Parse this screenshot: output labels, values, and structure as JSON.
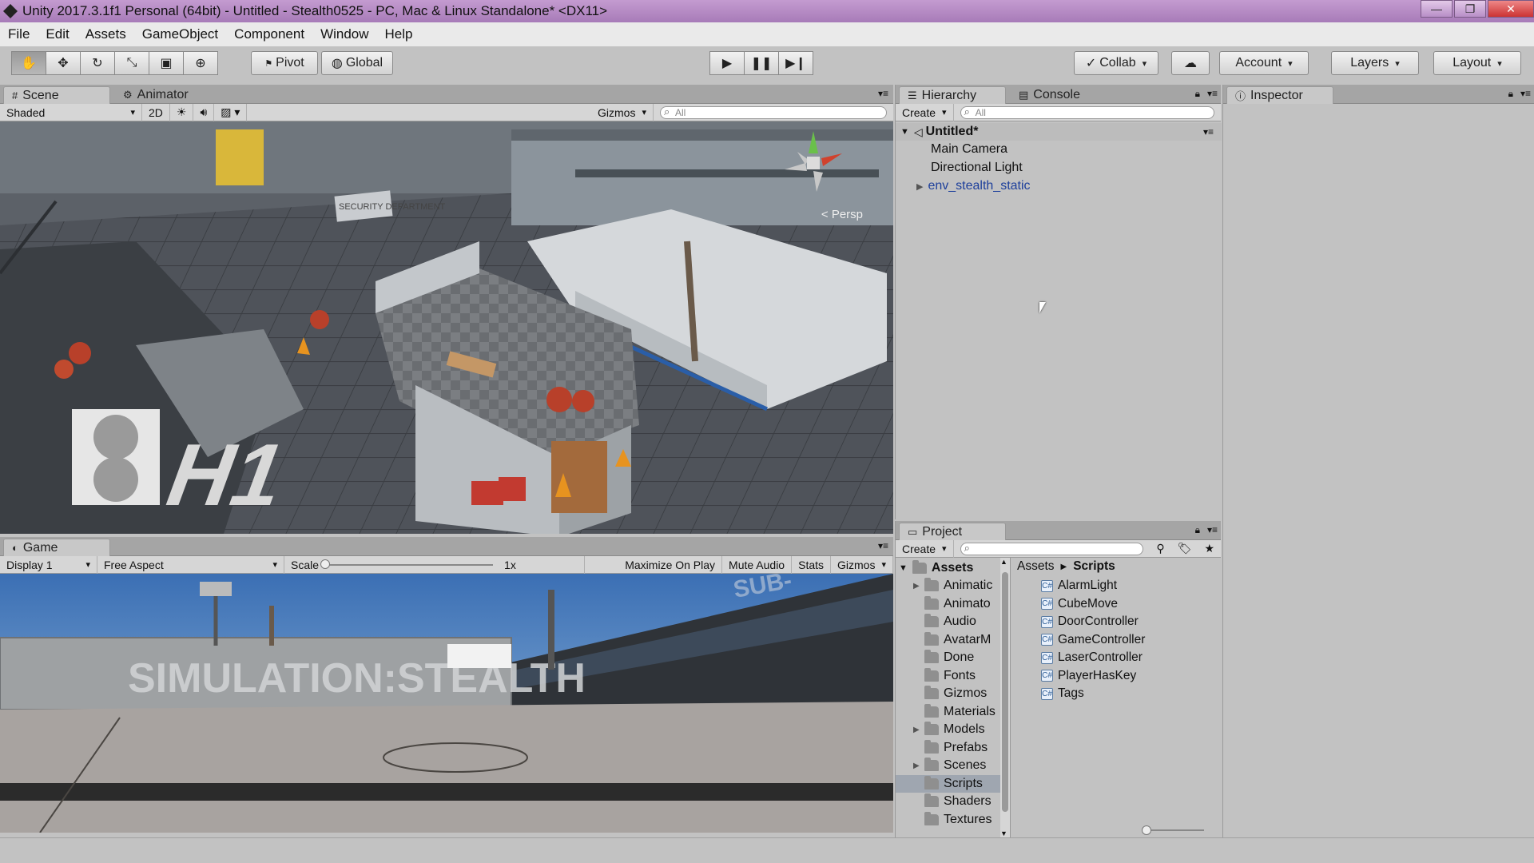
{
  "window": {
    "title": "Unity 2017.3.1f1 Personal (64bit) - Untitled - Stealth0525 - PC, Mac & Linux Standalone* <DX11>",
    "minimize": "—",
    "restore": "❐",
    "close": "✕"
  },
  "menu": [
    "File",
    "Edit",
    "Assets",
    "GameObject",
    "Component",
    "Window",
    "Help"
  ],
  "toolbar": {
    "pivot": "Pivot",
    "global": "Global",
    "collab": "Collab",
    "account": "Account",
    "layers": "Layers",
    "layout": "Layout"
  },
  "scene": {
    "tab_scene": "Scene",
    "tab_animator": "Animator",
    "shading": "Shaded",
    "mode2d": "2D",
    "gizmos": "Gizmos",
    "search_placeholder": "All",
    "persp_label": "Persp",
    "signs": {
      "security": "SECURITY DEPARTMENT",
      "pad": "H1"
    }
  },
  "hierarchy": {
    "tab_hierarchy": "Hierarchy",
    "tab_console": "Console",
    "create": "Create",
    "search_placeholder": "All",
    "scene_name": "Untitled*",
    "items": [
      "Main Camera",
      "Directional Light",
      "env_stealth_static"
    ]
  },
  "inspector": {
    "tab": "Inspector"
  },
  "game": {
    "tab": "Game",
    "display": "Display 1",
    "aspect": "Free Aspect",
    "scale_label": "Scale",
    "scale_value": "1x",
    "maximize": "Maximize On Play",
    "mute": "Mute Audio",
    "stats": "Stats",
    "gizmos": "Gizmos",
    "wall_text": "SIMULATION:STEALTH",
    "hangar_text": "SUB-"
  },
  "project": {
    "tab": "Project",
    "create": "Create",
    "root": "Assets",
    "folders": [
      "Animatic",
      "Animato",
      "Audio",
      "AvatarM",
      "Done",
      "Fonts",
      "Gizmos",
      "Materials",
      "Models",
      "Prefabs",
      "Scenes",
      "Scripts",
      "Shaders",
      "Textures"
    ],
    "expandable_folders": [
      0,
      8,
      10
    ],
    "selected_folder": 11,
    "breadcrumb": [
      "Assets",
      "Scripts"
    ],
    "files": [
      "AlarmLight",
      "CubeMove",
      "DoorController",
      "GameController",
      "LaserController",
      "PlayerHasKey",
      "Tags"
    ]
  },
  "colors": {
    "accent_select": "#3d6fc4",
    "panel": "#c2c2c2",
    "title_bar": "#b68ac3"
  }
}
